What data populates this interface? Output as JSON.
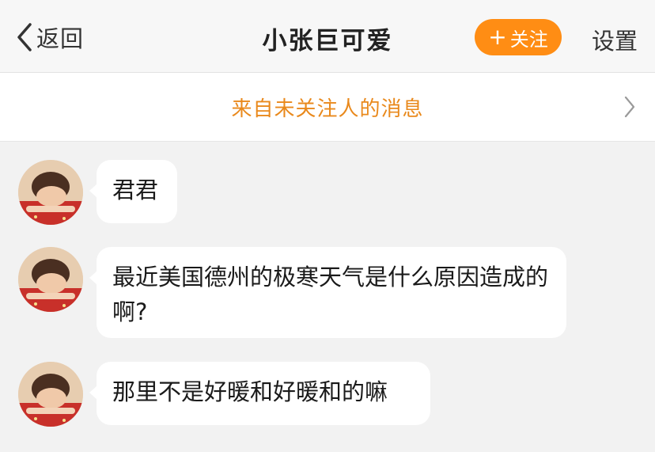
{
  "nav": {
    "back_label": "返回",
    "title": "小张巨可爱",
    "follow_label": "关注",
    "follow_plus": "+",
    "settings_label": "设置"
  },
  "notice": {
    "text": "来自未关注人的消息"
  },
  "messages": [
    {
      "text": "君君"
    },
    {
      "text": "最近美国德州的极寒天气是什么原因造成的啊?"
    },
    {
      "text": "那里不是好暖和好暖和的嘛"
    }
  ],
  "icons": {
    "back": "chevron-left-icon",
    "notice_arrow": "chevron-right-icon",
    "avatar": "user-avatar-photo"
  },
  "colors": {
    "accent": "#ff8d14",
    "notice_text": "#e9891c",
    "background": "#f2f2f2"
  }
}
